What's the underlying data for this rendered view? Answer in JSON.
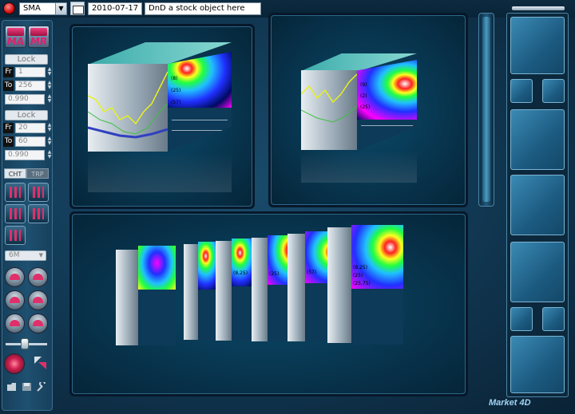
{
  "toolbar": {
    "indicator_select": "SMA",
    "indicator_select_arrow": "▼",
    "date_value": "2010-07-17",
    "symbol_input_placeholder": "DnD a stock object here"
  },
  "left_panel": {
    "ma_button_label": "MA",
    "mr_button_label": "MR",
    "lock1_label": "Lock",
    "fr_label": "Fr",
    "to_label": "To",
    "fr1_value": "1",
    "to1_value": "256",
    "ratio1_value": "0.990",
    "lock2_label": "Lock",
    "fr2_value": "20",
    "to2_value": "60",
    "ratio2_value": "0.990",
    "tab_cht": "CHT",
    "tab_trp": "TRP",
    "period_select": "6M",
    "period_arrow": "▼"
  },
  "cube_labels": [
    "(8)",
    "(25)",
    "(57)",
    "(9)",
    "(2)",
    "(25)",
    "(8,25)",
    "(25)",
    "(57)",
    "(8,25)",
    "(25)",
    "(25,75)"
  ],
  "brand": "Market 4D",
  "colors": {
    "accent": "#e0306a",
    "panel_bg": "#0b4a6a"
  }
}
